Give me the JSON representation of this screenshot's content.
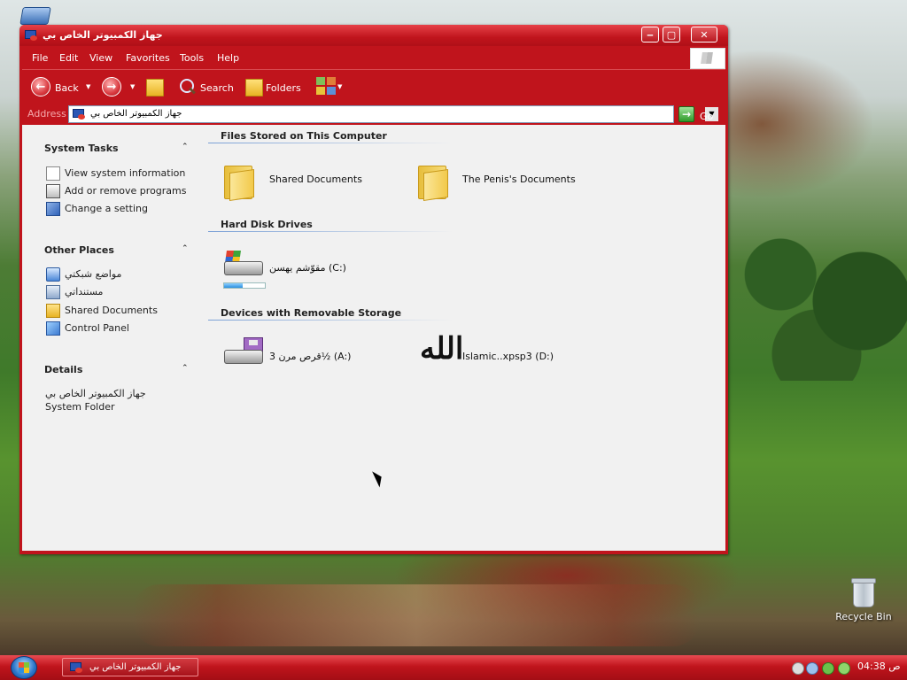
{
  "window": {
    "title": "جهاز الكمبيوتر الخاص بي",
    "controls": {
      "minimize": "‒",
      "maximize": "▢",
      "close": "✕"
    }
  },
  "menubar": [
    "File",
    "Edit",
    "View",
    "Favorites",
    "Tools",
    "Help"
  ],
  "toolbar": {
    "back": "Back",
    "search": "Search",
    "folders": "Folders",
    "icons": [
      "back-icon",
      "forward-icon",
      "up-folder-icon",
      "search-icon",
      "folders-icon",
      "views-icon"
    ]
  },
  "address": {
    "label": "Address",
    "value": "جهاز الكمبيوتر الخاص بي",
    "go": "Go"
  },
  "taskpane": {
    "system_tasks": {
      "title": "System Tasks",
      "items": [
        "View system information",
        "Add or remove programs",
        "Change a setting"
      ]
    },
    "other_places": {
      "title": "Other Places",
      "items": [
        "مواضع شبكتي",
        "مستنداتي",
        "Shared Documents",
        "Control Panel"
      ]
    },
    "details": {
      "title": "Details",
      "name": "جهاز الكمبيوتر الخاص بي",
      "type": "System Folder"
    }
  },
  "groups": {
    "files": {
      "title": "Files Stored on This Computer",
      "items": [
        "Shared Documents",
        "The Penis's Documents"
      ]
    },
    "hard_disks": {
      "title": "Hard Disk Drives",
      "items": [
        {
          "label": "مقوّشم يهسن (C:)",
          "used_fraction": 0.45
        }
      ]
    },
    "removable": {
      "title": "Devices with Removable Storage",
      "items": [
        "قرص مرن 3½ (A:)",
        "Islamic..xpsp3 (D:)"
      ],
      "cd_glyph": "الله"
    }
  },
  "desktop": {
    "recycle_bin": "Recycle Bin"
  },
  "taskbar": {
    "task_button": "جهاز الكمبيوتر الخاص بي",
    "clock": "04:38 ص"
  },
  "colors": {
    "theme_red": "#c0141c",
    "content_bg": "#f1f1f1",
    "group_rule": "#7aa0d6"
  }
}
